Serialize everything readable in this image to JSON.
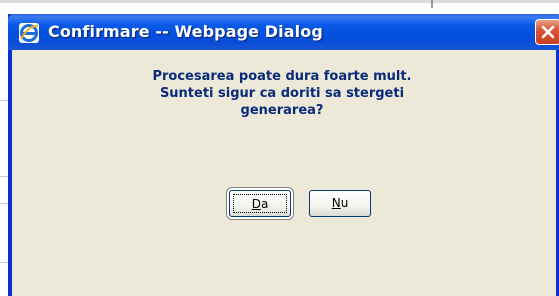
{
  "window": {
    "title": "Confirmare -- Webpage Dialog",
    "icon": "internet-explorer-icon",
    "close_icon": "close-icon"
  },
  "message": {
    "lines": [
      "Procesarea poate dura foarte mult.",
      "Sunteti sigur ca doriti sa stergeti",
      "generarea?"
    ]
  },
  "buttons": {
    "yes_label": "Da",
    "no_label": "Nu"
  },
  "colors": {
    "titlebar": "#0a5ae8",
    "dialog_bg": "#ece9d8",
    "message_text": "#0a2a7a",
    "close_button": "#d9573a",
    "frame_border": "#0831d9"
  }
}
